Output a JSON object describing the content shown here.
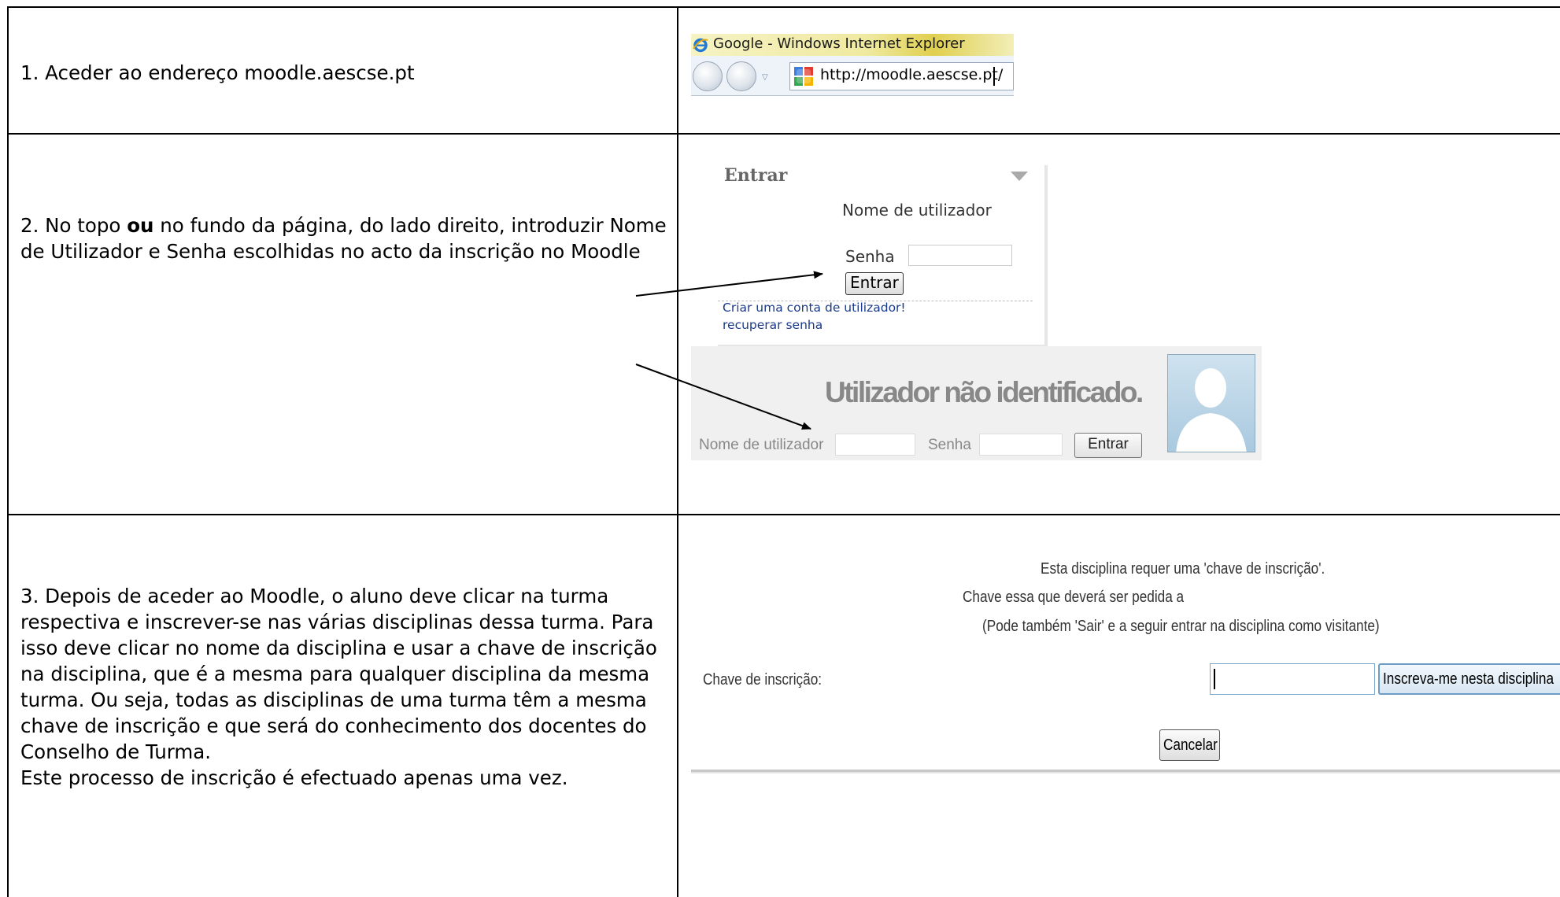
{
  "steps": [
    {
      "text": "1.  Aceder ao endereço moodle.aescse.pt"
    },
    {
      "text_before": "2.  No topo ",
      "text_bold": "ou",
      "text_after": " no fundo da página, do lado direito, introduzir Nome de Utilizador e Senha escolhidas no acto da inscrição no Moodle"
    },
    {
      "paragraph1": "3.  Depois de aceder ao Moodle, o aluno deve clicar na turma respectiva e inscrever-se nas várias disciplinas dessa turma. Para isso deve clicar no nome da disciplina e usar a chave de inscrição na disciplina, que é a mesma para qualquer disciplina da mesma turma. Ou seja, todas as disciplinas de uma turma têm a mesma chave de inscrição e que será do conhecimento dos docentes do Conselho de Turma.",
      "paragraph2": "Este processo de inscrição é efectuado apenas uma vez."
    }
  ],
  "browser": {
    "title": "Google - Windows Internet Explorer",
    "url": "http://moodle.aescse.pt/"
  },
  "login_block": {
    "header": "Entrar",
    "username_label": "Nome de utilizador",
    "password_label": "Senha",
    "button": "Entrar",
    "create_account_link": "Criar uma conta de utilizador!",
    "recover_password_link": "recuperar senha"
  },
  "guest_block": {
    "heading": "Utilizador não identificado.",
    "username_label": "Nome de utilizador",
    "password_label": "Senha",
    "button": "Entrar"
  },
  "enrol": {
    "line1": "Esta disciplina requer uma 'chave de inscrição'.",
    "line2": "Chave essa que deverá ser pedida a",
    "line3": "(Pode também 'Sair' e a seguir entrar na disciplina como visitante)",
    "key_label": "Chave de inscrição:",
    "submit_button": "Inscreva-me nesta disciplina",
    "cancel_button": "Cancelar"
  },
  "icons": {
    "browser_logo": "internet-explorer-icon",
    "back": "back-arrow-icon",
    "forward": "forward-arrow-icon",
    "favicon": "google-favicon-icon",
    "collapse": "triangle-down-icon",
    "avatar": "user-silhouette-icon",
    "arrow": "pointer-arrow-icon"
  },
  "colors": {
    "link": "#1a3a8a",
    "grid": "#000000",
    "guest_background": "#f0f0f0"
  }
}
